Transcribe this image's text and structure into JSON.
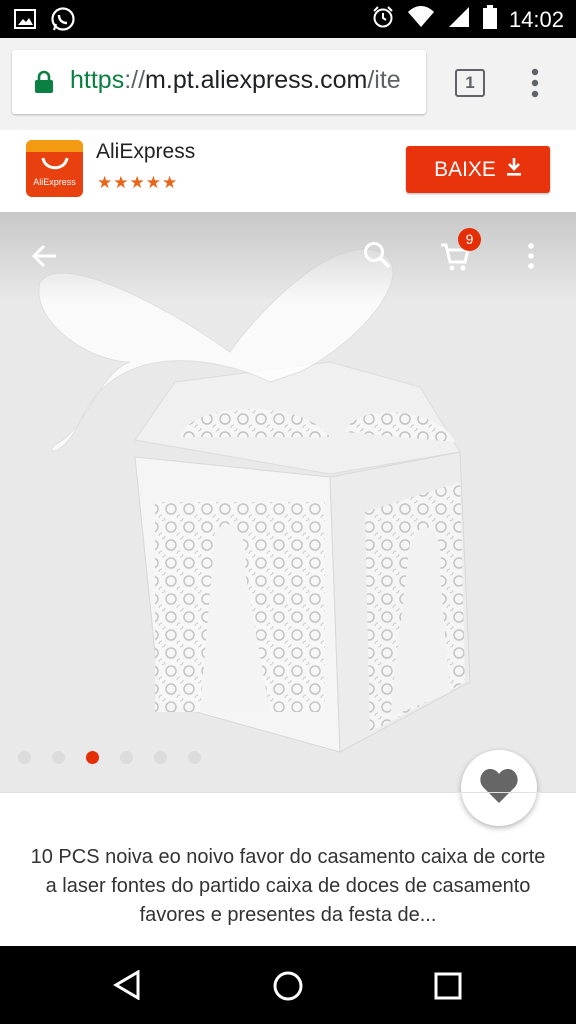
{
  "status_bar": {
    "time": "14:02",
    "icons": [
      "image-icon",
      "whatsapp-icon",
      "alarm-icon",
      "wifi-icon",
      "signal-icon",
      "battery-icon"
    ]
  },
  "browser": {
    "url_scheme": "https",
    "url_sep": "://",
    "url_host": "m.pt.aliexpress.com",
    "url_path": "/ite",
    "tab_count": "1"
  },
  "app_banner": {
    "app_name": "AliExpress",
    "logo_text": "AliExpress",
    "rating_stars": "★★★★★",
    "install_label": "BAIXE",
    "brand_color": "#e8330d"
  },
  "product": {
    "cart_count": "9",
    "image_count": 6,
    "active_image_index": 2,
    "title": "10 PCS noiva eo noivo favor do casamento caixa de corte a laser fontes do partido caixa de doces de casamento favores e presentes da festa de..."
  },
  "colors": {
    "accent": "#e62e04",
    "secure_green": "#0b8043"
  }
}
